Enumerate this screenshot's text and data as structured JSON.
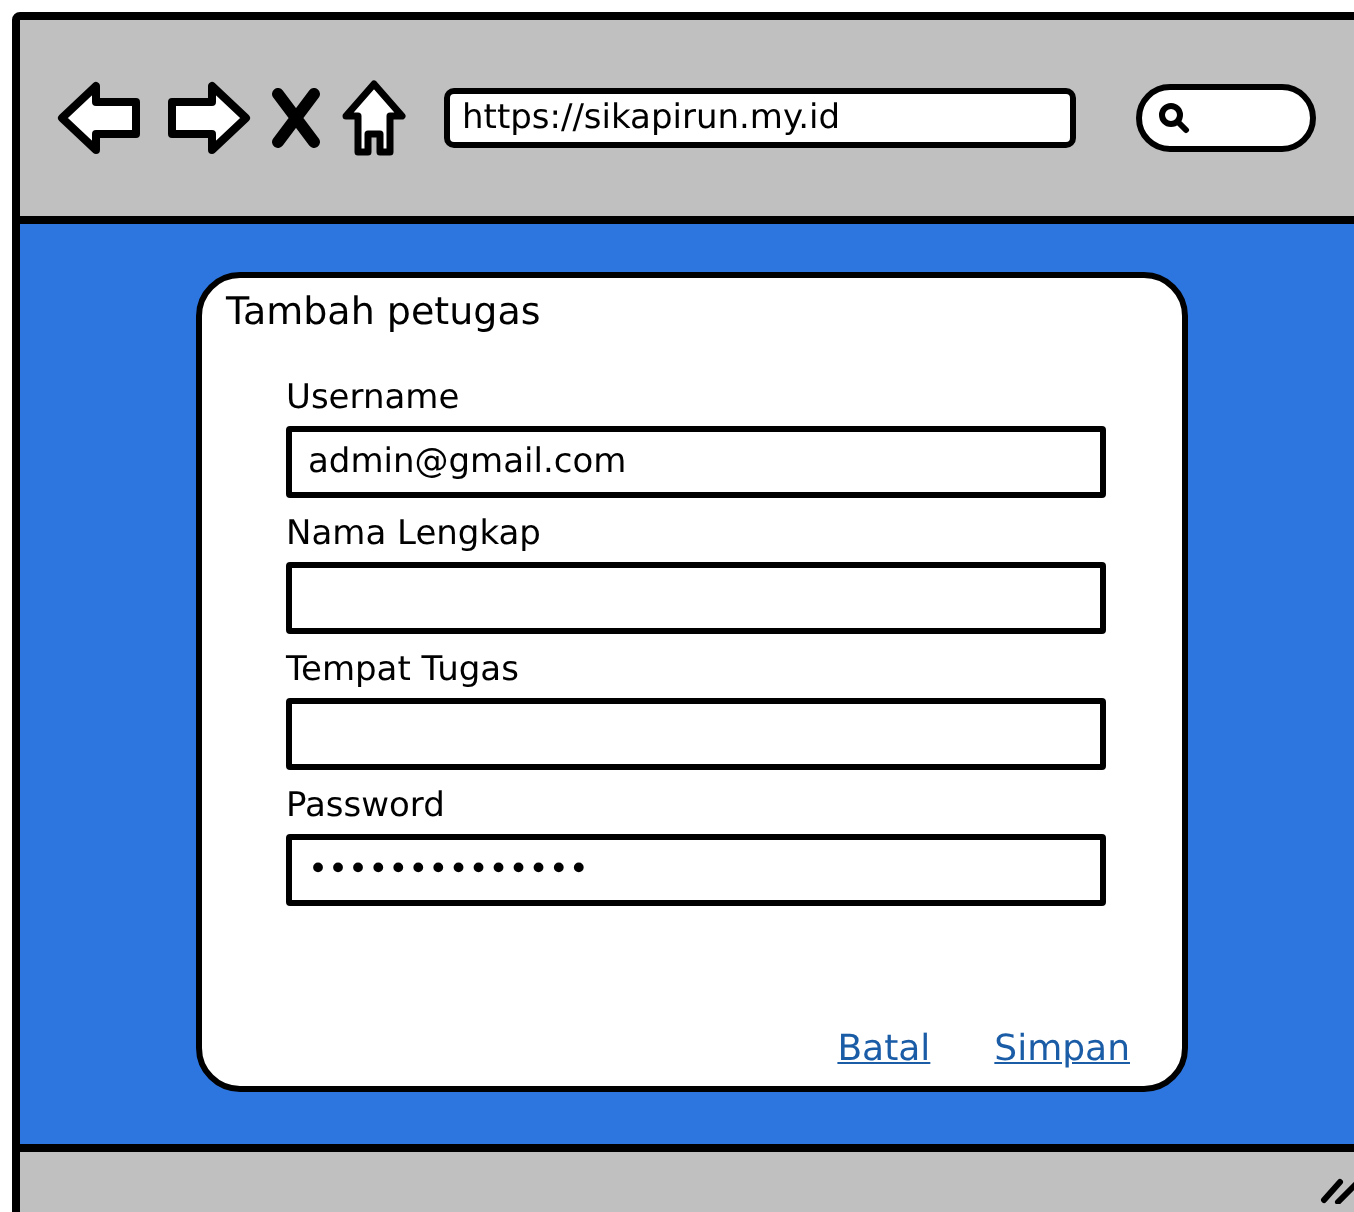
{
  "browser": {
    "url": "https://sikapirun.my.id"
  },
  "dialog": {
    "title": "Tambah petugas",
    "fields": [
      {
        "label": "Username",
        "value": "admin@gmail.com"
      },
      {
        "label": "Nama Lengkap"
      },
      {
        "label": "Tempat Tugas"
      },
      {
        "label": "Password",
        "value": "••••••••••••••"
      }
    ],
    "links": [
      "Batal",
      "Simpan"
    ]
  }
}
